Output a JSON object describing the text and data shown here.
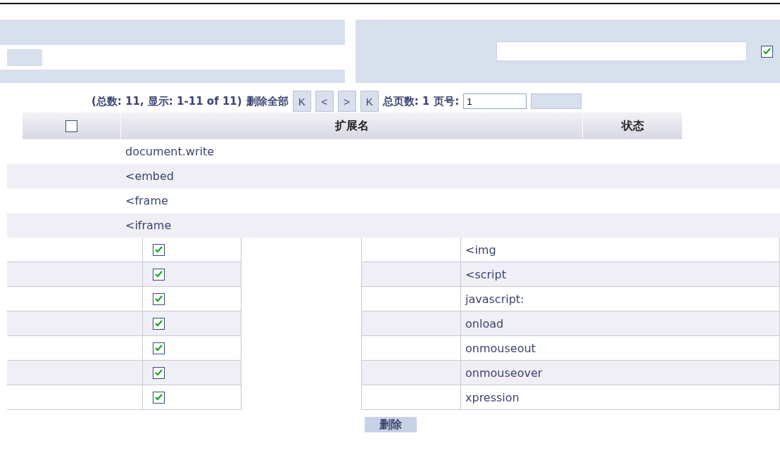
{
  "filter": {
    "checked": true
  },
  "pager": {
    "summary": "(总数: 11, 显示: 1-11 of 11)",
    "delete_all": "删除全部",
    "nav": [
      "K",
      "<",
      ">",
      "K"
    ],
    "total_pages": "总页数: 1",
    "page_label": "页号:",
    "page_value": "1"
  },
  "table": {
    "header_checkbox": {
      "checked": false
    },
    "columns": [
      "扩展名",
      "状态"
    ],
    "rows": [
      {
        "kind": "plain",
        "name": "document.write"
      },
      {
        "kind": "plain",
        "name": "<embed"
      },
      {
        "kind": "plain",
        "name": "<frame"
      },
      {
        "kind": "plain",
        "name": "<iframe"
      },
      {
        "kind": "check",
        "checked": true,
        "name": "<img"
      },
      {
        "kind": "check",
        "checked": true,
        "name": "<script"
      },
      {
        "kind": "check",
        "checked": true,
        "name": "javascript:"
      },
      {
        "kind": "check",
        "checked": true,
        "name": "onload"
      },
      {
        "kind": "check",
        "checked": true,
        "name": "onmouseout"
      },
      {
        "kind": "check",
        "checked": true,
        "name": "onmouseover"
      },
      {
        "kind": "check",
        "checked": true,
        "name": "xpression"
      }
    ]
  },
  "delete_button": "删除"
}
